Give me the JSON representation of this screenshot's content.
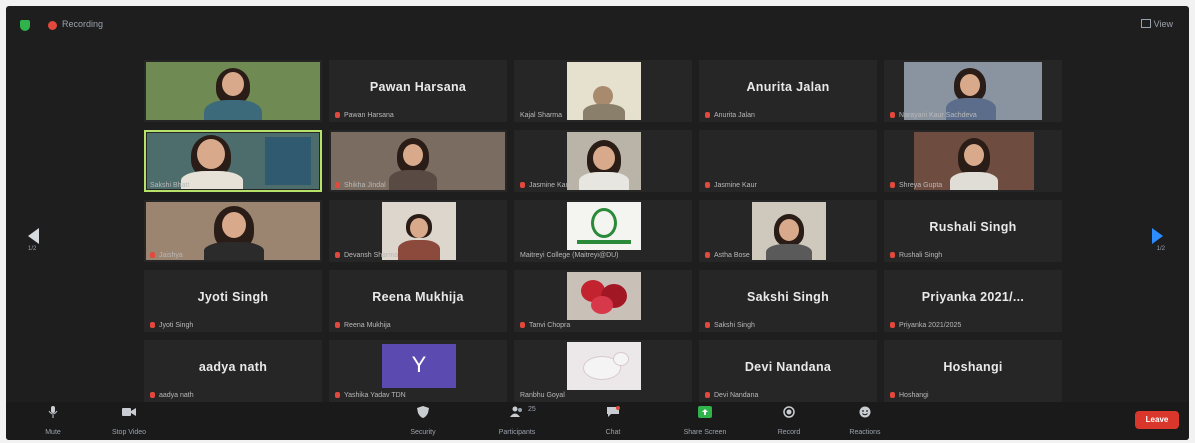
{
  "topbar": {
    "recording_label": "Recording",
    "view_label": "View"
  },
  "navigation": {
    "left_page": "1/2",
    "right_page": "1/2"
  },
  "tiles": [
    {
      "name": "",
      "label": ""
    },
    {
      "name": "Pawan Harsana",
      "label": "Pawan Harsana"
    },
    {
      "name": "",
      "label": "Kajal Sharma"
    },
    {
      "name": "Anurita Jalan",
      "label": "Anurita Jalan"
    },
    {
      "name": "",
      "label": "Narayani Kaur Sachdeva"
    },
    {
      "name": "",
      "label": "Sakshi Bhatt"
    },
    {
      "name": "",
      "label": "Shikha Jindal"
    },
    {
      "name": "",
      "label": "Jasmine Kaur"
    },
    {
      "name": "",
      "label": "Jasmine Kaur"
    },
    {
      "name": "",
      "label": "Shreya Gupta"
    },
    {
      "name": "",
      "label": "Jaishya"
    },
    {
      "name": "",
      "label": "Devansh Sharma"
    },
    {
      "name": "",
      "label": "Maitreyi College (Maitreyi@DU)"
    },
    {
      "name": "",
      "label": "Astha Bose"
    },
    {
      "name": "Rushali Singh",
      "label": "Rushali Singh"
    },
    {
      "name": "Jyoti Singh",
      "label": "Jyoti Singh"
    },
    {
      "name": "Reena Mukhija",
      "label": "Reena Mukhija"
    },
    {
      "name": "",
      "label": "Tanvi Chopra"
    },
    {
      "name": "Sakshi Singh",
      "label": "Sakshi Singh"
    },
    {
      "name": "Priyanka 2021/...",
      "label": "Priyanka 2021/2025"
    },
    {
      "name": "aadya nath",
      "label": "aadya nath"
    },
    {
      "name": "",
      "label": "Yashika Yadav TDN"
    },
    {
      "name": "",
      "label": "Ranbhu Goyal"
    },
    {
      "name": "Devi Nandana",
      "label": "Devi Nandana"
    },
    {
      "name": "Hoshangi",
      "label": "Hoshangi"
    }
  ],
  "avatar_letter": "Y",
  "toolbar": {
    "mute": "Mute",
    "stop_video": "Stop Video",
    "security": "Security",
    "participants": "Participants",
    "participants_count": "25",
    "chat": "Chat",
    "share_screen": "Share Screen",
    "record": "Record",
    "reactions": "Reactions",
    "leave": "Leave"
  },
  "colors": {
    "background": "#1e1e1e",
    "tile": "#262626",
    "active_speaker": "#b6e26a",
    "share_green": "#2fb34a",
    "leave_red": "#d9372b",
    "accent_blue": "#2d8cff"
  }
}
